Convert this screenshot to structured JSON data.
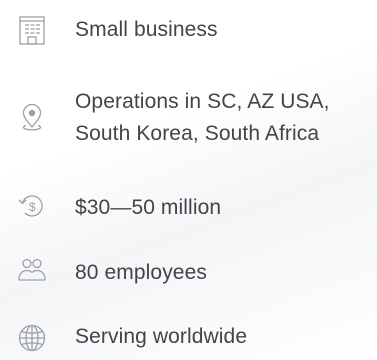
{
  "facts": {
    "items": [
      {
        "icon": "building-icon",
        "text": "Small business"
      },
      {
        "icon": "location-pin-icon",
        "line1": "Operations in SC, AZ USA,",
        "line2": "South Korea, South Africa"
      },
      {
        "icon": "money-cycle-icon",
        "text": "$30—50 million"
      },
      {
        "icon": "people-icon",
        "text": "80 employees"
      },
      {
        "icon": "globe-icon",
        "text": "Serving worldwide"
      }
    ]
  },
  "colors": {
    "icon": "#9aa0a6",
    "text": "#414448"
  }
}
